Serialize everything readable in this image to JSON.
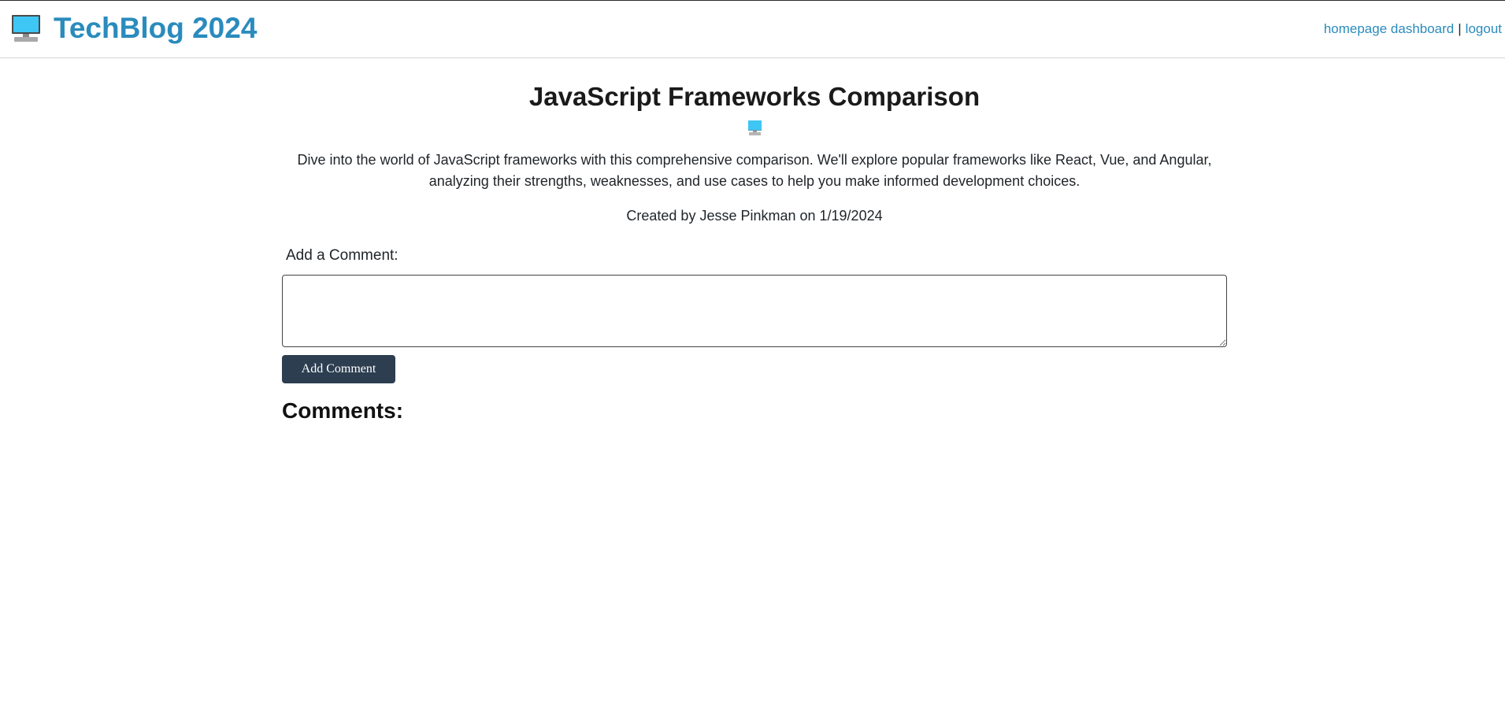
{
  "header": {
    "brand_icon": "desktop-computer-icon",
    "title": "TechBlog 2024",
    "nav": {
      "homepage_label": "homepage",
      "dashboard_label": "dashboard",
      "separator": "|",
      "logout_label": "logout"
    }
  },
  "post": {
    "title": "JavaScript Frameworks Comparison",
    "thumbnail_icon": "desktop-computer-icon",
    "body": "Dive into the world of JavaScript frameworks with this comprehensive comparison. We'll explore popular frameworks like React, Vue, and Angular, analyzing their strengths, weaknesses, and use cases to help you make informed development choices.",
    "meta": "Created by Jesse Pinkman on 1/19/2024"
  },
  "comment_form": {
    "label": "Add a Comment:",
    "value": "",
    "button_label": "Add Comment"
  },
  "comments": {
    "heading": "Comments:",
    "items": []
  },
  "colors": {
    "brand": "#2a8bbd",
    "button_bg": "#2c3e50",
    "text": "#212529"
  }
}
